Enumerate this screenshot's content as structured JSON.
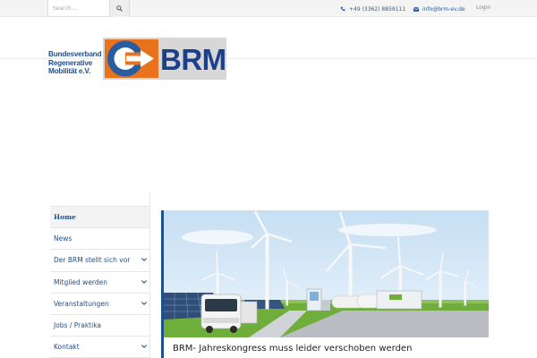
{
  "topbar": {
    "search_placeholder": "Search...",
    "phone": "+49 (3362) 8859111",
    "email": "info@brm-ev.de",
    "login": "Login"
  },
  "header": {
    "org_name_lines": [
      "Bundesverband",
      "Regenerative",
      "Mobilität e.V."
    ],
    "logo_word": "BRM"
  },
  "sidebar": {
    "items": [
      {
        "label": "Home",
        "active": true,
        "has_submenu": false
      },
      {
        "label": "News",
        "active": false,
        "has_submenu": false
      },
      {
        "label": "Der BRM stellt sich vor",
        "active": false,
        "has_submenu": true
      },
      {
        "label": "Mitglied werden",
        "active": false,
        "has_submenu": true
      },
      {
        "label": "Veranstaltungen",
        "active": false,
        "has_submenu": true
      },
      {
        "label": "Jobs / Praktika",
        "active": false,
        "has_submenu": false
      },
      {
        "label": "Kontakt",
        "active": false,
        "has_submenu": true
      }
    ]
  },
  "article": {
    "title": "BRM- Jahreskongress muss leider verschoben werden"
  },
  "colors": {
    "brand_blue": "#1d4f91",
    "logo_orange": "#e8731c",
    "sky": "#d2e6f6",
    "grass": "#6fae3a"
  }
}
